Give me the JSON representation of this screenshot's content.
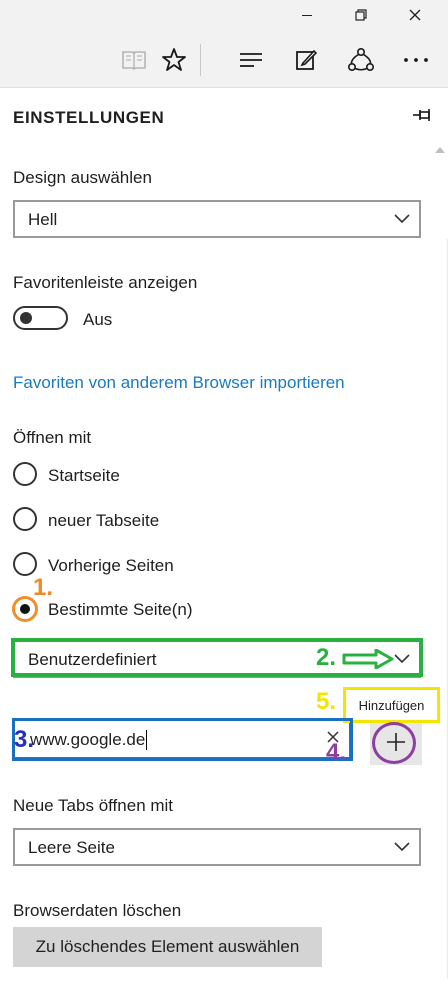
{
  "window": {
    "minimize_icon": "minimize-icon",
    "restore_icon": "restore-icon",
    "close_icon": "close-icon"
  },
  "toolbar": {
    "icons": [
      "reading-view-icon",
      "favorite-star-icon",
      "hub-icon",
      "web-note-icon",
      "share-icon",
      "more-icon"
    ]
  },
  "panel": {
    "heading": "EINSTELLUNGEN",
    "design_label": "Design auswählen",
    "design_value": "Hell",
    "favbar_label": "Favoritenleiste anzeigen",
    "favbar_state": "Aus",
    "import_link": "Favoriten von anderem Browser importieren",
    "open_with_label": "Öffnen mit",
    "radios": [
      {
        "label": "Startseite",
        "checked": false
      },
      {
        "label": "neuer Tabseite",
        "checked": false
      },
      {
        "label": "Vorherige Seiten",
        "checked": false
      },
      {
        "label": "Bestimmte Seite(n)",
        "checked": true
      }
    ],
    "pages_select_value": "Benutzerdefiniert",
    "add_tooltip": "Hinzufügen",
    "url_value": "www.google.de",
    "new_tabs_label": "Neue Tabs öffnen mit",
    "new_tabs_value": "Leere Seite",
    "clear_data_label": "Browserdaten löschen",
    "clear_data_button": "Zu löschendes Element auswählen"
  },
  "annotations": {
    "a1": "1.",
    "a2": "2.",
    "a3": "3.",
    "a4": "4.",
    "a5": "5."
  },
  "colors": {
    "accent_link": "#1a7bbf",
    "annotation_orange": "#f08a24",
    "annotation_green": "#2ab041",
    "annotation_blue": "#2630b8",
    "annotation_purple": "#8c3ea1",
    "annotation_yellow": "#f2e600"
  }
}
